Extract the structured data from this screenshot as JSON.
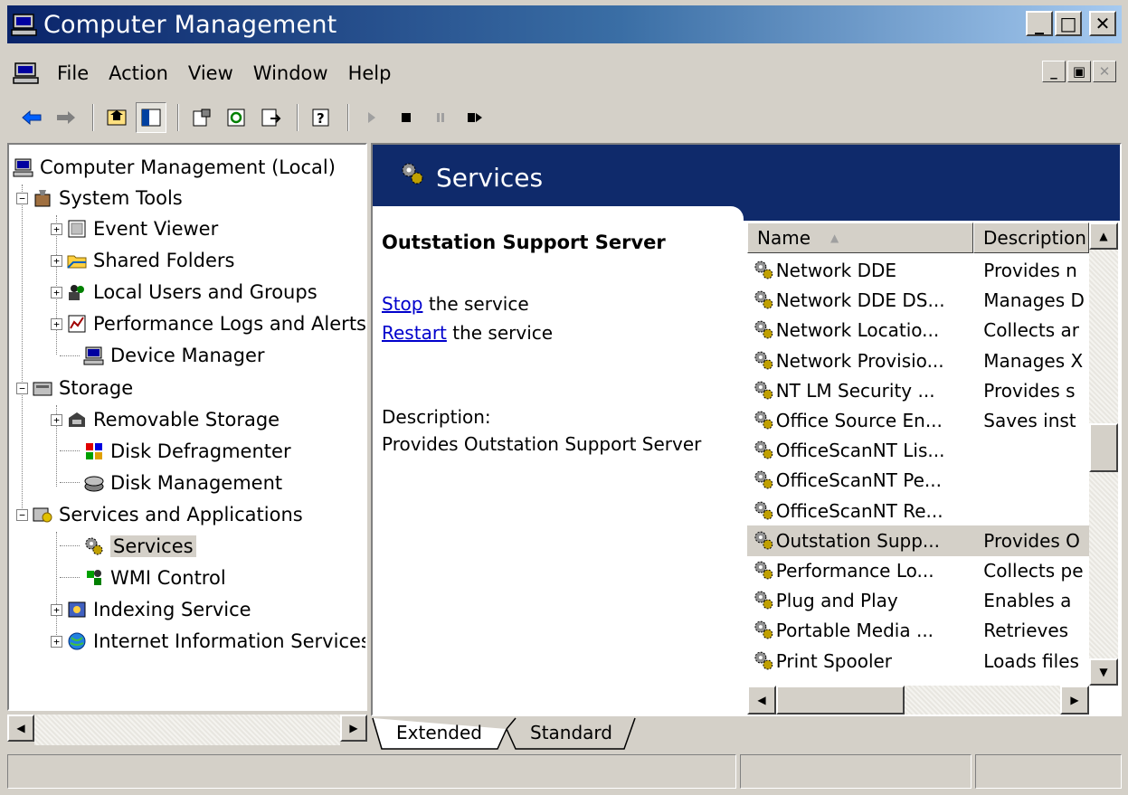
{
  "window": {
    "title": "Computer Management",
    "minimize": "_",
    "maximize": "□",
    "close": "✕"
  },
  "menu": {
    "items": [
      "File",
      "Action",
      "View",
      "Window",
      "Help"
    ],
    "mdi_minimize": "_",
    "mdi_restore": "▣",
    "mdi_close": "✕"
  },
  "toolbar": {
    "buttons": [
      "back-icon",
      "forward-icon",
      "up-folder-icon",
      "show-tree-icon",
      "properties-icon",
      "refresh-icon",
      "export-list-icon",
      "help-icon",
      "start-service-icon",
      "stop-service-icon",
      "pause-service-icon",
      "restart-service-icon"
    ]
  },
  "tree": {
    "root": "Computer Management (Local)",
    "items": [
      {
        "label": "System Tools",
        "level": 1,
        "expander": "−"
      },
      {
        "label": "Event Viewer",
        "level": 2,
        "expander": "+"
      },
      {
        "label": "Shared Folders",
        "level": 2,
        "expander": "+"
      },
      {
        "label": "Local Users and Groups",
        "level": 2,
        "expander": "+"
      },
      {
        "label": "Performance Logs and Alerts",
        "level": 2,
        "expander": "+"
      },
      {
        "label": "Device Manager",
        "level": 2,
        "expander": ""
      },
      {
        "label": "Storage",
        "level": 1,
        "expander": "−"
      },
      {
        "label": "Removable Storage",
        "level": 2,
        "expander": "+"
      },
      {
        "label": "Disk Defragmenter",
        "level": 2,
        "expander": ""
      },
      {
        "label": "Disk Management",
        "level": 2,
        "expander": ""
      },
      {
        "label": "Services and Applications",
        "level": 1,
        "expander": "−"
      },
      {
        "label": "Services",
        "level": 2,
        "expander": "",
        "selected": true
      },
      {
        "label": "WMI Control",
        "level": 2,
        "expander": ""
      },
      {
        "label": "Indexing Service",
        "level": 2,
        "expander": "+"
      },
      {
        "label": "Internet Information Services",
        "level": 2,
        "expander": "+"
      }
    ]
  },
  "banner": {
    "title": "Services"
  },
  "detail": {
    "service_name": "Outstation Support Server",
    "stop_link": "Stop",
    "stop_suffix": " the service",
    "restart_link": "Restart",
    "restart_suffix": " the service",
    "description_label": "Description:",
    "description_text": "Provides Outstation Support Server"
  },
  "services_list": {
    "columns": [
      "Name",
      "Description"
    ],
    "sort_indicator": "▲",
    "rows": [
      {
        "name": "Network DDE",
        "description": "Provides n"
      },
      {
        "name": "Network DDE DS...",
        "description": "Manages D"
      },
      {
        "name": "Network Locatio...",
        "description": "Collects ar"
      },
      {
        "name": "Network Provisio...",
        "description": "Manages X"
      },
      {
        "name": "NT LM Security ...",
        "description": "Provides s"
      },
      {
        "name": "Office Source En...",
        "description": "Saves inst"
      },
      {
        "name": "OfficeScanNT Lis...",
        "description": ""
      },
      {
        "name": "OfficeScanNT Pe...",
        "description": ""
      },
      {
        "name": "OfficeScanNT Re...",
        "description": ""
      },
      {
        "name": "Outstation Supp...",
        "description": "Provides O",
        "selected": true
      },
      {
        "name": "Performance Lo...",
        "description": "Collects pe"
      },
      {
        "name": "Plug and Play",
        "description": "Enables a"
      },
      {
        "name": "Portable Media ...",
        "description": "Retrieves"
      },
      {
        "name": "Print Spooler",
        "description": "Loads files"
      }
    ]
  },
  "tabs": [
    "Extended",
    "Standard"
  ],
  "statusbar": {
    "panels": [
      "",
      "",
      ""
    ]
  },
  "colors": {
    "titlebar_start": "#0a246a",
    "titlebar_end": "#a6caf0",
    "banner": "#0f2a6b",
    "link": "#0000cc",
    "chrome": "#d4d0c8"
  }
}
